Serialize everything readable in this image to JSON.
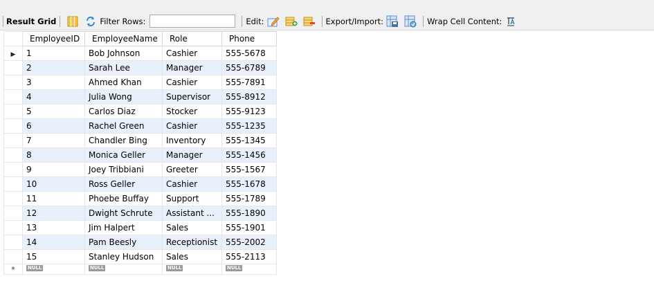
{
  "toolbar": {
    "result_grid_label": "Result Grid",
    "filter_rows_label": "Filter Rows:",
    "filter_value": "",
    "edit_label": "Edit:",
    "export_import_label": "Export/Import:",
    "wrap_label": "Wrap Cell Content:"
  },
  "grid": {
    "columns": [
      "EmployeeID",
      "EmployeeName",
      "Role",
      "Phone"
    ],
    "rows": [
      [
        "1",
        "Bob Johnson",
        "Cashier",
        "555-5678"
      ],
      [
        "2",
        "Sarah Lee",
        "Manager",
        "555-6789"
      ],
      [
        "3",
        "Ahmed Khan",
        "Cashier",
        "555-7891"
      ],
      [
        "4",
        "Julia Wong",
        "Supervisor",
        "555-8912"
      ],
      [
        "5",
        "Carlos Diaz",
        "Stocker",
        "555-9123"
      ],
      [
        "6",
        "Rachel Green",
        "Cashier",
        "555-1235"
      ],
      [
        "7",
        "Chandler Bing",
        "Inventory",
        "555-1345"
      ],
      [
        "8",
        "Monica Geller",
        "Manager",
        "555-1456"
      ],
      [
        "9",
        "Joey Tribbiani",
        "Greeter",
        "555-1567"
      ],
      [
        "10",
        "Ross Geller",
        "Cashier",
        "555-1678"
      ],
      [
        "11",
        "Phoebe Buffay",
        "Support",
        "555-1789"
      ],
      [
        "12",
        "Dwight Schrute",
        "Assistant ...",
        "555-1890"
      ],
      [
        "13",
        "Jim Halpert",
        "Sales",
        "555-1901"
      ],
      [
        "14",
        "Pam Beesly",
        "Receptionist",
        "555-2002"
      ],
      [
        "15",
        "Stanley Hudson",
        "Sales",
        "555-2113"
      ]
    ],
    "null_label": "NULL",
    "current_row_marker": "▶",
    "new_row_marker": "*"
  }
}
